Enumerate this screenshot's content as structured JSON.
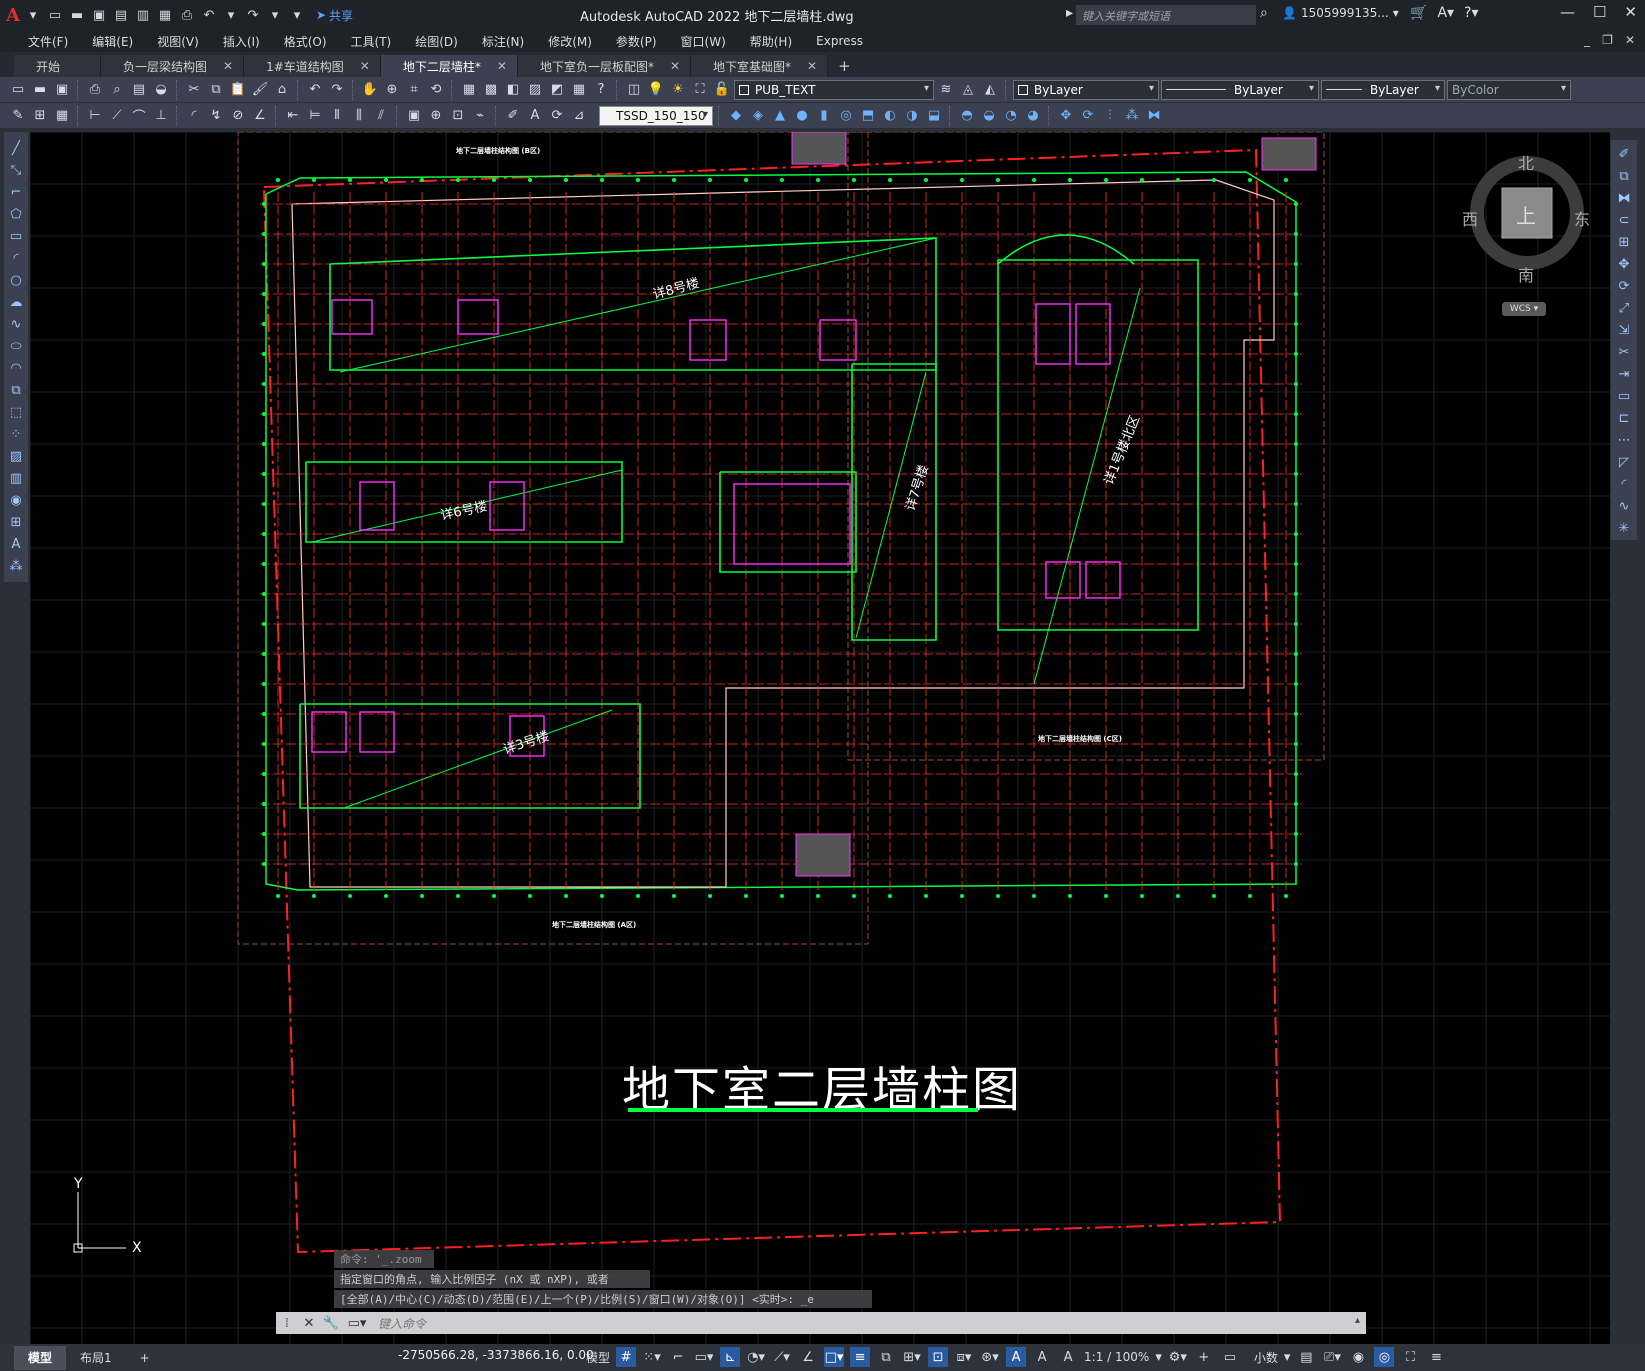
{
  "app": {
    "logo": "A",
    "title": "Autodesk AutoCAD 2022    地下二层墙柱.dwg",
    "share_label": "共享",
    "search_placeholder": "键入关键字或短语",
    "user": "1505999135...",
    "colors": {
      "bg": "#000000",
      "grid": "#ff3030",
      "wall": "#00ff40",
      "accent": "#e03030"
    }
  },
  "menu": [
    "文件(F)",
    "编辑(E)",
    "视图(V)",
    "插入(I)",
    "格式(O)",
    "工具(T)",
    "绘图(D)",
    "标注(N)",
    "修改(M)",
    "参数(P)",
    "窗口(W)",
    "帮助(H)",
    "Express"
  ],
  "tabs": [
    {
      "label": "开始",
      "active": false,
      "closable": false
    },
    {
      "label": "负一层梁结构图",
      "active": false,
      "closable": true
    },
    {
      "label": "1#车道结构图",
      "active": false,
      "closable": true
    },
    {
      "label": "地下二层墙柱*",
      "active": true,
      "closable": true
    },
    {
      "label": "地下室负一层板配图*",
      "active": false,
      "closable": true
    },
    {
      "label": "地下室基础图*",
      "active": false,
      "closable": true
    }
  ],
  "toolbar": {
    "layer": "PUB_TEXT",
    "color": "ByLayer",
    "linetype": "ByLayer",
    "lineweight": "ByLayer",
    "plotstyle": "ByColor",
    "textstyle": "TSSD_150_150"
  },
  "viewcube": {
    "north": "北",
    "south": "南",
    "east": "东",
    "west": "西",
    "top": "上",
    "wcs": "WCS"
  },
  "drawing": {
    "main_title": "地下室二层墙柱图",
    "plan_a": "地下二层墙柱结构图 (A区)",
    "plan_b": "地下二层墙柱结构图 (B区)",
    "plan_c": "地下二层墙柱结构图 (C区)",
    "b8": "详8号楼",
    "b6": "详6号楼",
    "b7": "详7号楼",
    "b3": "详3号楼",
    "b1": "详1号楼北区"
  },
  "ucs": {
    "x": "X",
    "y": "Y"
  },
  "command": {
    "history": [
      "命令: '_.zoom",
      "指定窗口的角点, 输入比例因子 (nX 或 nXP), 或者",
      "[全部(A)/中心(C)/动态(D)/范围(E)/上一个(P)/比例(S)/窗口(W)/对象(O)] <实时>: _e"
    ],
    "prompt": "键入命令"
  },
  "status": {
    "model_tab": "模型",
    "layout_tab": "布局1",
    "coords": "-2750566.28, -3373866.16, 0.00",
    "space": "模型",
    "scale": "1:1 / 100%",
    "units": "小数"
  }
}
